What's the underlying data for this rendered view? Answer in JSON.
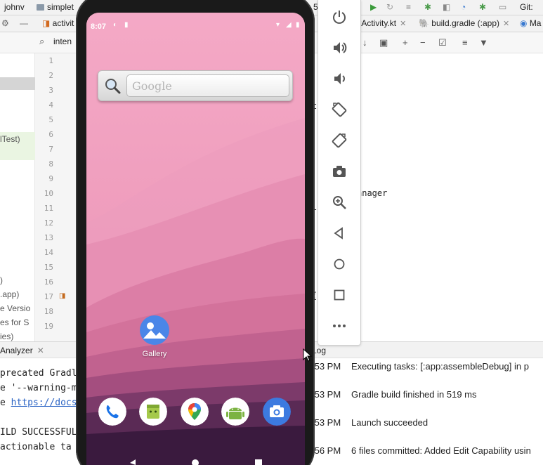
{
  "ide": {
    "top_bar": {
      "user": "johnv",
      "project": "simplet",
      "tail": "5",
      "git": "Git:"
    },
    "tabs": {
      "left": "activit",
      "mid": "tActivity.kt",
      "gradle": "build.gradle (:app)",
      "right": "Ma"
    },
    "search_text": "inten",
    "project_panel": {
      "item1": "lTest)",
      "item2": ")",
      "item3": ".app)",
      "item4": "e Versio",
      "item5": "es for S",
      "item6": "ies)"
    },
    "gutter_lines": [
      "1",
      "2",
      "3",
      "4",
      "5",
      "6",
      "7",
      "8",
      "9",
      "10",
      "11",
      "12",
      "13",
      "14",
      "15",
      "16",
      "17",
      "18",
      "19"
    ],
    "editor": {
      "line_a": "t",
      "line_b": "anager",
      "line_c": "l",
      "line_d": "{"
    },
    "bottom_bar": {
      "left_tab": "Analyzer",
      "right_tab": "Log"
    },
    "console_lines": {
      "l1": "precated Gradl",
      "l2": "e '--warning-m",
      "l3_prefix": "e ",
      "l3_link": "https://docs",
      "l4": "ILD SUCCESSFUL",
      "l5": " actionable ta"
    },
    "event_log": [
      {
        "time": ":53 PM",
        "message": "Executing tasks: [:app:assembleDebug] in p"
      },
      {
        "time": ":53 PM",
        "message": "Gradle build finished in 519 ms"
      },
      {
        "time": ":53 PM",
        "message": "Launch succeeded"
      },
      {
        "time": ":56 PM",
        "message": "6 files committed: Added Edit Capability usin"
      }
    ]
  },
  "emulator": {
    "status_time": "8:07",
    "search_widget_text": "Google",
    "gallery_label": "Gallery",
    "dock_apps": [
      "Phone",
      "Messages",
      "Maps",
      "Android",
      "Camera"
    ],
    "toolbar_icons": [
      "power-icon",
      "volume-up-icon",
      "volume-down-icon",
      "rotate-left-icon",
      "rotate-right-icon",
      "screenshot-icon",
      "zoom-icon",
      "back-icon",
      "home-icon",
      "overview-icon",
      "more-icon"
    ],
    "colors": {
      "wall_top": "#f4a9c6",
      "wall_bottom": "#3a1a3e",
      "accent": "#3c7ae0"
    }
  }
}
